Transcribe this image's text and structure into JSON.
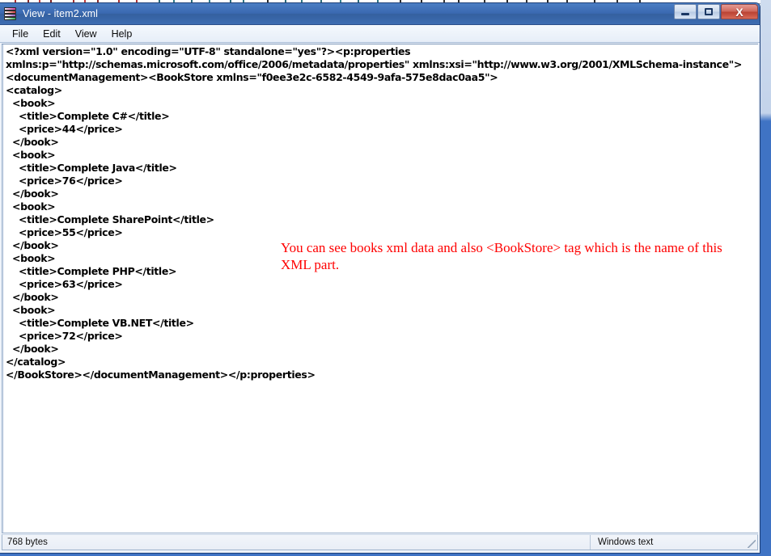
{
  "window": {
    "title": "View - item2.xml",
    "icon": "winrar-books-icon",
    "controls": {
      "minimize_label": "–",
      "maximize_label": "□",
      "close_label": "X"
    }
  },
  "menu": {
    "items": [
      {
        "label": "File"
      },
      {
        "label": "Edit"
      },
      {
        "label": "View"
      },
      {
        "label": "Help"
      }
    ]
  },
  "document": {
    "xml_text": "<?xml version=\"1.0\" encoding=\"UTF-8\" standalone=\"yes\"?><p:properties\nxmlns:p=\"http://schemas.microsoft.com/office/2006/metadata/properties\" xmlns:xsi=\"http://www.w3.org/2001/XMLSchema-instance\">\n<documentManagement><BookStore xmlns=\"f0ee3e2c-6582-4549-9afa-575e8dac0aa5\">\n<catalog>\n  <book>\n    <title>Complete C#</title>\n    <price>44</price>\n  </book>\n  <book>\n    <title>Complete Java</title>\n    <price>76</price>\n  </book>\n  <book>\n    <title>Complete SharePoint</title>\n    <price>55</price>\n  </book>\n  <book>\n    <title>Complete PHP</title>\n    <price>63</price>\n  </book>\n  <book>\n    <title>Complete VB.NET</title>\n    <price>72</price>\n  </book>\n</catalog>\n</BookStore></documentManagement></p:properties>",
    "xml_declaration": {
      "version": "1.0",
      "encoding": "UTF-8",
      "standalone": "yes"
    },
    "namespaces": {
      "p": "http://schemas.microsoft.com/office/2006/metadata/properties",
      "xsi": "http://www.w3.org/2001/XMLSchema-instance",
      "bookstore": "f0ee3e2c-6582-4549-9afa-575e8dac0aa5"
    },
    "catalog": [
      {
        "title": "Complete C#",
        "price": "44"
      },
      {
        "title": "Complete Java",
        "price": "76"
      },
      {
        "title": "Complete SharePoint",
        "price": "55"
      },
      {
        "title": "Complete PHP",
        "price": "63"
      },
      {
        "title": "Complete VB.NET",
        "price": "72"
      }
    ]
  },
  "annotation": {
    "text": "You can see books xml data and also <BookStore> tag which is the name of this XML part.",
    "color": "#ff0000"
  },
  "status_bar": {
    "size": "768 bytes",
    "encoding": "Windows text"
  },
  "colors": {
    "title_bar": "#3a68b0",
    "close_button": "#ba4334",
    "annotation": "#ff0000",
    "background_window": "#3f73c4"
  }
}
